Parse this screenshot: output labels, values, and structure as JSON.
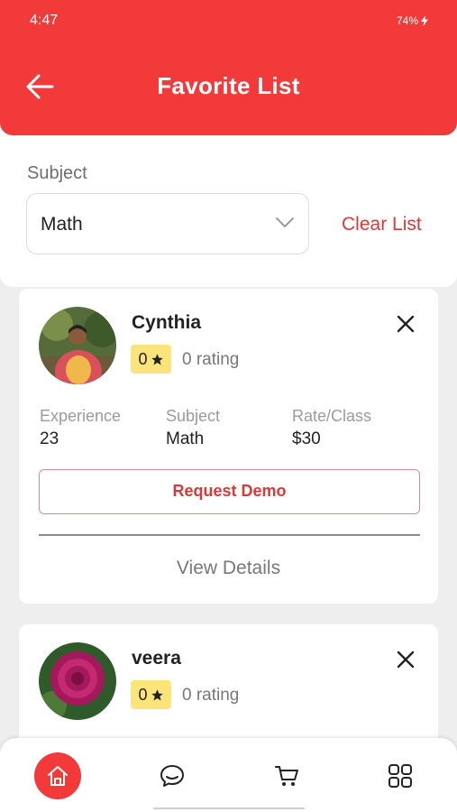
{
  "status_bar": {
    "time": "4:47",
    "battery": "74%"
  },
  "header": {
    "title": "Favorite List"
  },
  "filter": {
    "subject_label": "Subject",
    "subject_value": "Math",
    "clear_label": "Clear List"
  },
  "tutors": [
    {
      "name": "Cynthia",
      "rating": "0",
      "rating_text": "0 rating",
      "experience_label": "Experience",
      "experience": "23",
      "subject_label": "Subject",
      "subject": "Math",
      "rate_label": "Rate/Class",
      "rate": "$30",
      "demo_label": "Request Demo",
      "details_label": "View Details"
    },
    {
      "name": "veera",
      "rating": "0",
      "rating_text": "0 rating"
    }
  ],
  "bottom_nav": [
    "home-icon",
    "chat-icon",
    "cart-icon",
    "grid-icon"
  ],
  "colors": {
    "accent": "#f23a3a",
    "badge": "#fbe47a",
    "link": "#d63a3a"
  }
}
